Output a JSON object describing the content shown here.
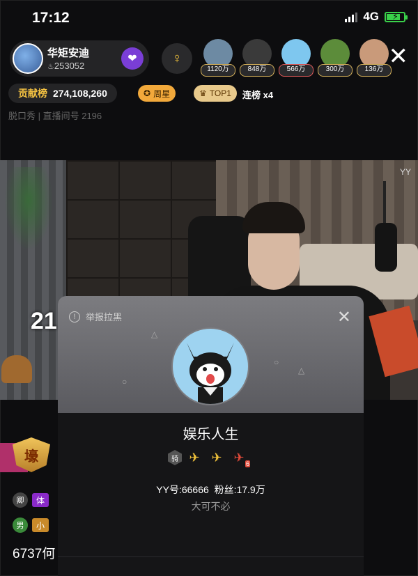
{
  "status": {
    "time": "17:12",
    "network": "4G",
    "battery_level": 0.8
  },
  "host": {
    "name": "华矩安迪",
    "id": "253052"
  },
  "viewers": [
    {
      "count": "1120万",
      "color": "#6d8aa3"
    },
    {
      "count": "848万",
      "color": "#3a3a3a"
    },
    {
      "count": "566万",
      "color": "#7ec7ef"
    },
    {
      "count": "300万",
      "color": "#5c8c3a"
    },
    {
      "count": "136万",
      "color": "#c99a7a"
    }
  ],
  "contrib": {
    "label": "贡献榜",
    "value": "274,108,260"
  },
  "badges": {
    "week": "周星",
    "top": "TOP1",
    "streak": "连榜 x4"
  },
  "subinfo": "脱口秀 | 直播间号 2196",
  "video": {
    "corner_text": "21",
    "watermark": "YY"
  },
  "chat": {
    "badge_char": "壕",
    "rows": [
      {
        "level": "卿",
        "tag": "体"
      },
      {
        "level": "男",
        "tag": "小"
      }
    ],
    "big_text": "6737何"
  },
  "card": {
    "report_label": "举报拉黑",
    "name": "娱乐人生",
    "yy_label": "YY号:",
    "yy_number": "66666",
    "fans_label": "粉丝:",
    "fans_value": "17.9万",
    "signature": "大可不必",
    "badge_level": "6"
  }
}
